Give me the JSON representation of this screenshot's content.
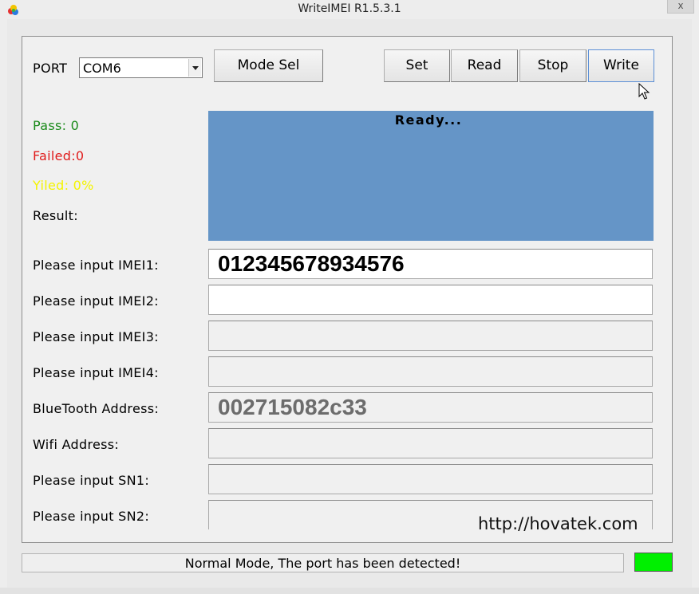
{
  "window": {
    "title": "WriteIMEI R1.5.3.1",
    "close_glyph": "x"
  },
  "toolbar": {
    "port_label": "PORT",
    "port_value": "COM6",
    "mode_sel_label": "Mode Sel",
    "set_label": "Set",
    "read_label": "Read",
    "stop_label": "Stop",
    "write_label": "Write"
  },
  "stats": {
    "pass_label": "Pass:  0",
    "failed_label": "Failed:0",
    "yield_label": "Yiled: 0%",
    "result_label": "Result:"
  },
  "status_display": {
    "text": "Ready..."
  },
  "fields": [
    {
      "label": "Please input IMEI1:",
      "value": "012345678934576"
    },
    {
      "label": "Please input IMEI2:",
      "value": ""
    },
    {
      "label": "Please input IMEI3:",
      "value": ""
    },
    {
      "label": "Please input IMEI4:",
      "value": ""
    },
    {
      "label": "BlueTooth Address:",
      "value": "002715082c33"
    },
    {
      "label": "Wifi Address:",
      "value": ""
    },
    {
      "label": "Please input SN1:",
      "value": ""
    },
    {
      "label": "Please input SN2:",
      "value": ""
    }
  ],
  "watermark": "http://hovatek.com",
  "statusbar": {
    "text": "Normal Mode, The port has been detected!"
  },
  "colors": {
    "pass": "#1a8a1a",
    "failed": "#e01b1b",
    "yield": "#f4f400",
    "status_display_bg": "#6595c7",
    "indicator": "#00f000",
    "bt_value": "#6c6c6c"
  },
  "icons": {
    "app": "app-logo-icon",
    "cursor": "mouse-pointer-icon"
  }
}
